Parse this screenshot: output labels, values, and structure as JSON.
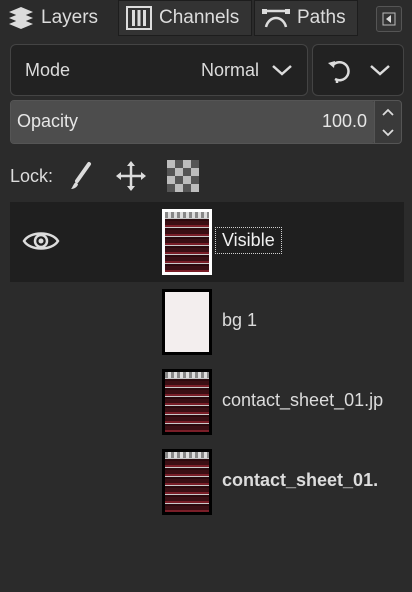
{
  "tabs": [
    {
      "label": "Layers",
      "icon": "layers-icon"
    },
    {
      "label": "Channels",
      "icon": "channels-icon"
    },
    {
      "label": "Paths",
      "icon": "paths-icon"
    }
  ],
  "mode": {
    "label": "Mode",
    "value": "Normal"
  },
  "opacity": {
    "label": "Opacity",
    "value": "100.0",
    "fraction": 1.0
  },
  "lock": {
    "label": "Lock:"
  },
  "layers": [
    {
      "name": "Visible",
      "visible": true,
      "selected": true,
      "thumb": "sheet"
    },
    {
      "name": "bg 1",
      "visible": false,
      "selected": false,
      "thumb": "plain"
    },
    {
      "name": "contact_sheet_01.jp",
      "visible": false,
      "selected": false,
      "thumb": "sheet"
    },
    {
      "name": "contact_sheet_01.",
      "visible": false,
      "selected": false,
      "thumb": "sheet",
      "bold": true
    }
  ],
  "colors": {
    "background": "#2b2b2b",
    "selected_row": "#1f1f1f",
    "text": "#dcdcdc"
  }
}
